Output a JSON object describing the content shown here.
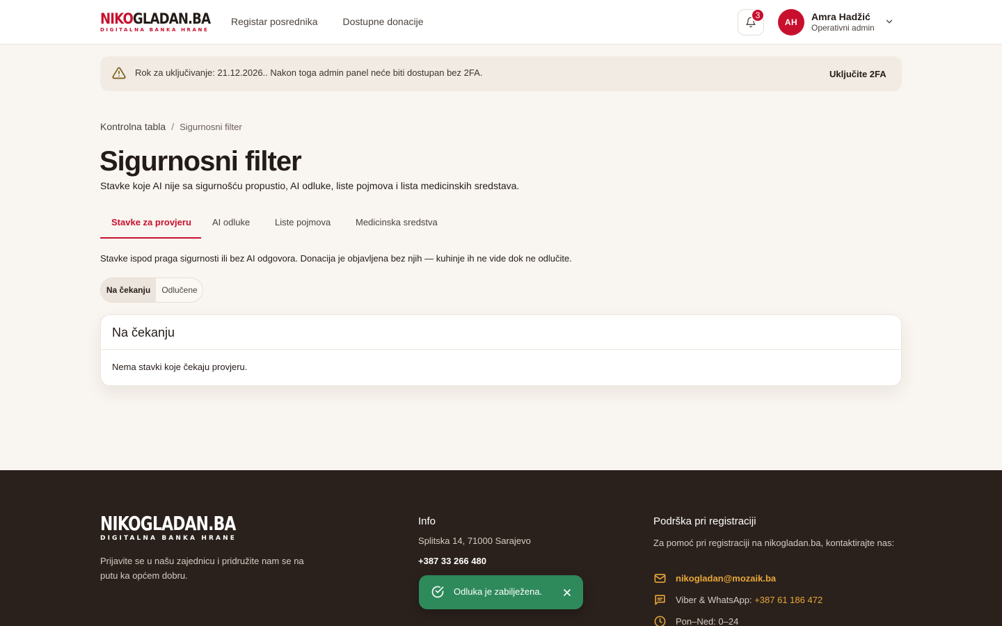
{
  "header": {
    "logo_main_a": "NIKO",
    "logo_main_b": "GLADAN.BA",
    "logo_sub": "DIGITALNA BANKA HRANE",
    "nav": [
      {
        "label": "Registar posrednika"
      },
      {
        "label": "Dostupne donacije"
      }
    ],
    "notifications_count": "3",
    "user": {
      "initials": "AH",
      "name": "Amra Hadžić",
      "role": "Operativni admin"
    }
  },
  "banner": {
    "text": "Rok za uključivanje: 21.12.2026.. Nakon toga admin panel neće biti dostupan bez 2FA.",
    "action": "Uključite 2FA"
  },
  "breadcrumb": {
    "parent": "Kontrolna tabla",
    "separator": "/",
    "current": "Sigurnosni filter"
  },
  "page": {
    "title": "Sigurnosni filter",
    "subtitle": "Stavke koje AI nije sa sigurnošću propustio, AI odluke, liste pojmova i lista medicinskih sredstava."
  },
  "tabs": [
    {
      "label": "Stavke za provjeru",
      "active": true
    },
    {
      "label": "AI odluke"
    },
    {
      "label": "Liste pojmova"
    },
    {
      "label": "Medicinska sredstva"
    }
  ],
  "description": "Stavke ispod praga sigurnosti ili bez AI odgovora. Donacija je objavljena bez njih — kuhinje ih ne vide dok ne odlučite.",
  "filter": {
    "options": [
      "Na čekanju",
      "Odlučene"
    ],
    "selected": "Na čekanju"
  },
  "card": {
    "title": "Na čekanju",
    "empty": "Nema stavki koje čekaju provjeru."
  },
  "footer": {
    "logo_main": "NIKOGLADAN.BA",
    "logo_sub": "DIGITALNA BANKA HRANE",
    "about": "Prijavite se u našu zajednicu i pridružite nam se na putu ka općem dobru.",
    "info": {
      "heading": "Info",
      "address": "Splitska 14, 71000 Sarajevo",
      "phone": "+387 33 266 480"
    },
    "support": {
      "heading": "Podrška pri registraciji",
      "text": "Za pomoć pri registraciji na nikogladan.ba, kontaktirajte nas:",
      "email": "nikogladan@mozaik.ba",
      "messenger_label": "Viber & WhatsApp:",
      "messenger_phone": "+387 61 186 472",
      "hours": "Pon–Ned: 0–24"
    }
  },
  "toast": {
    "text": "Odluka je zabilježena."
  },
  "colors": {
    "brand": "#c8102e",
    "footer_bg": "#2b211c",
    "link_accent": "#e8a83a",
    "toast_bg": "#2e8a5b"
  }
}
